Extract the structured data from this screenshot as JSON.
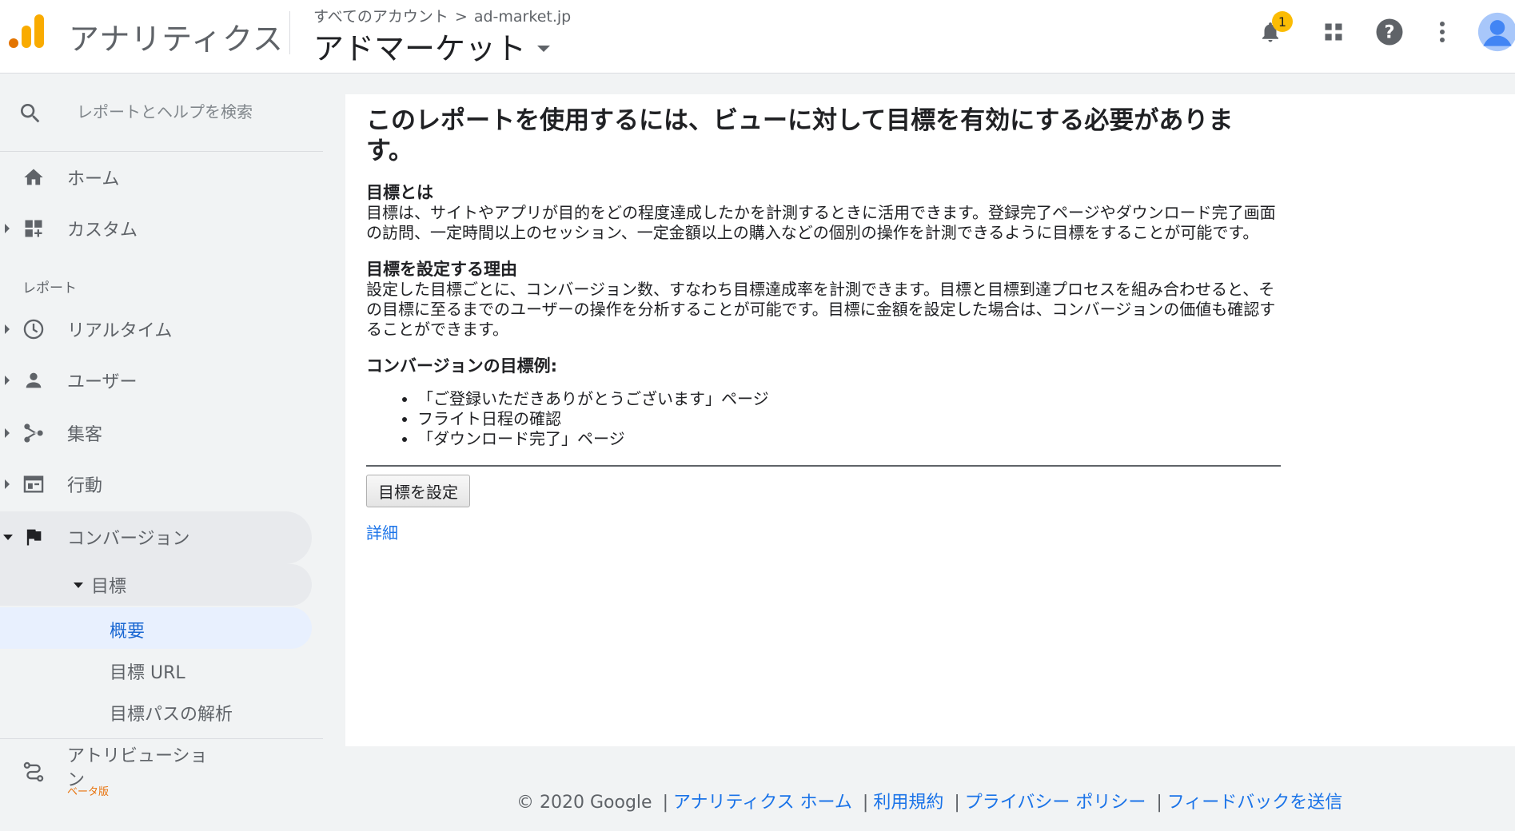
{
  "header": {
    "app_title": "アナリティクス",
    "breadcrumb_account": "すべてのアカウント",
    "breadcrumb_separator": ">",
    "breadcrumb_property": "ad-market.jp",
    "property_name": "アドマーケット",
    "notification_count": "1",
    "brand_colors": {
      "logo_orange": "#f9ab00",
      "logo_dark": "#e37400",
      "avatar_blue": "#4285f4"
    }
  },
  "sidebar": {
    "search_placeholder": "レポートとヘルプを検索",
    "home": "ホーム",
    "custom": "カスタム",
    "reports_section": "レポート",
    "realtime": "リアルタイム",
    "users": "ユーザー",
    "acquisition": "集客",
    "behavior": "行動",
    "conversions": "コンバージョン",
    "goals": "目標",
    "goals_overview": "概要",
    "goals_url": "目標 URL",
    "goals_funnel": "目標パスの解析",
    "attribution": "アトリビューション",
    "attribution_line2": "ン",
    "attribution_line1": "アトリビューショ",
    "beta": "ベータ版"
  },
  "main": {
    "title": "このレポートを使用するには、ビューに対して目標を有効にする必要がありま す。",
    "title_line1": "このレポートを使用するには、ビューに対して目標を有効にする必要がありま",
    "title_line2": "す。",
    "what_heading": "目標とは",
    "what_text": "目標は、サイトやアプリが目的をどの程度達成したかを計測するときに活用できます。登録完了ページやダウンロード完了画面の訪問、一定時間以上のセッション、一定金額以上の購入などの個別の操作を計測できるように目標をすることが可能です。",
    "why_heading": "目標を設定する理由",
    "why_text": "設定した目標ごとに、コンバージョン数、すなわち目標達成率を計測できます。目標と目標到達プロセスを組み合わせると、その目標に至るまでのユーザーの操作を分析することが可能です。目標に金額を設定した場合は、コンバージョンの価値も確認することができます。",
    "examples_heading": "コンバージョンの目標例:",
    "examples": [
      "「ご登録いただきありがとうございます」ページ",
      "フライト日程の確認",
      "「ダウンロード完了」ページ"
    ],
    "set_goal_button": "目標を設定",
    "details_link": "詳細"
  },
  "footer": {
    "copyright": "© 2020 Google",
    "separator": "|",
    "links": [
      "アナリティクス ホーム",
      "利用規約",
      "プライバシー ポリシー",
      "フィードバックを送信"
    ]
  }
}
